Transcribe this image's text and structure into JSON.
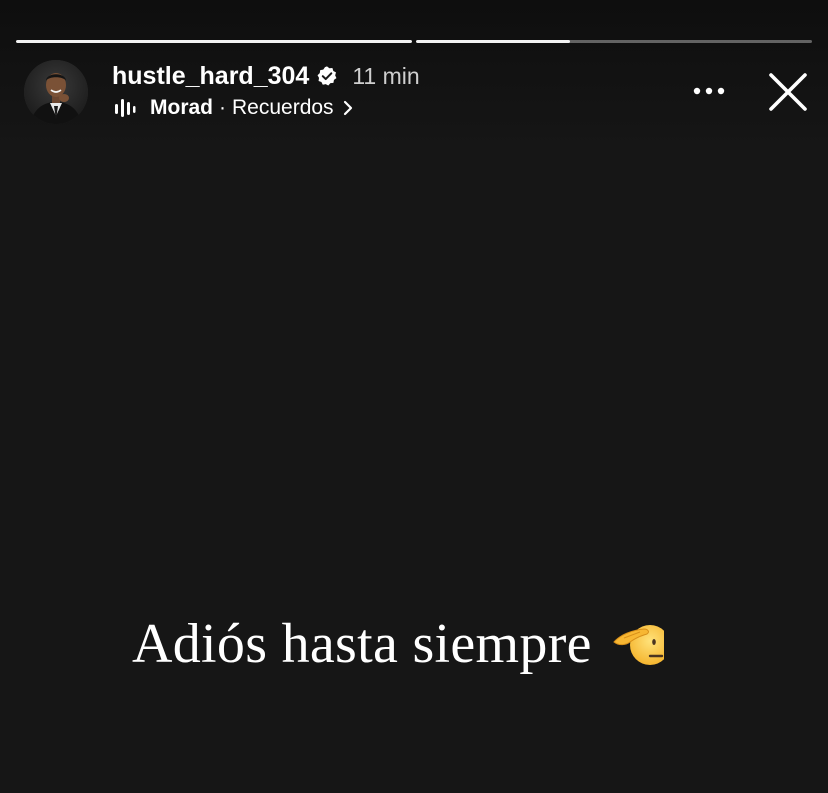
{
  "story": {
    "progress": [
      1.0,
      0.39
    ],
    "username": "hustle_hard_304",
    "time_ago": "11 min",
    "music": {
      "artist": "Morad",
      "separator": "·",
      "song": "Recuerdos"
    },
    "caption": "Adiós hasta siempre",
    "icons": {
      "verified": "verified-badge-icon",
      "music": "music-bars-icon",
      "chevron": "chevron-right-icon",
      "more": "more-dots-icon",
      "close": "close-icon",
      "emoji": "saluting-face-emoji"
    }
  },
  "colors": {
    "background": "#161616",
    "progress_filled": "#f2f2f2",
    "progress_track": "#5c5c5c",
    "text": "#ffffff",
    "time_text": "#cfcfcf"
  }
}
